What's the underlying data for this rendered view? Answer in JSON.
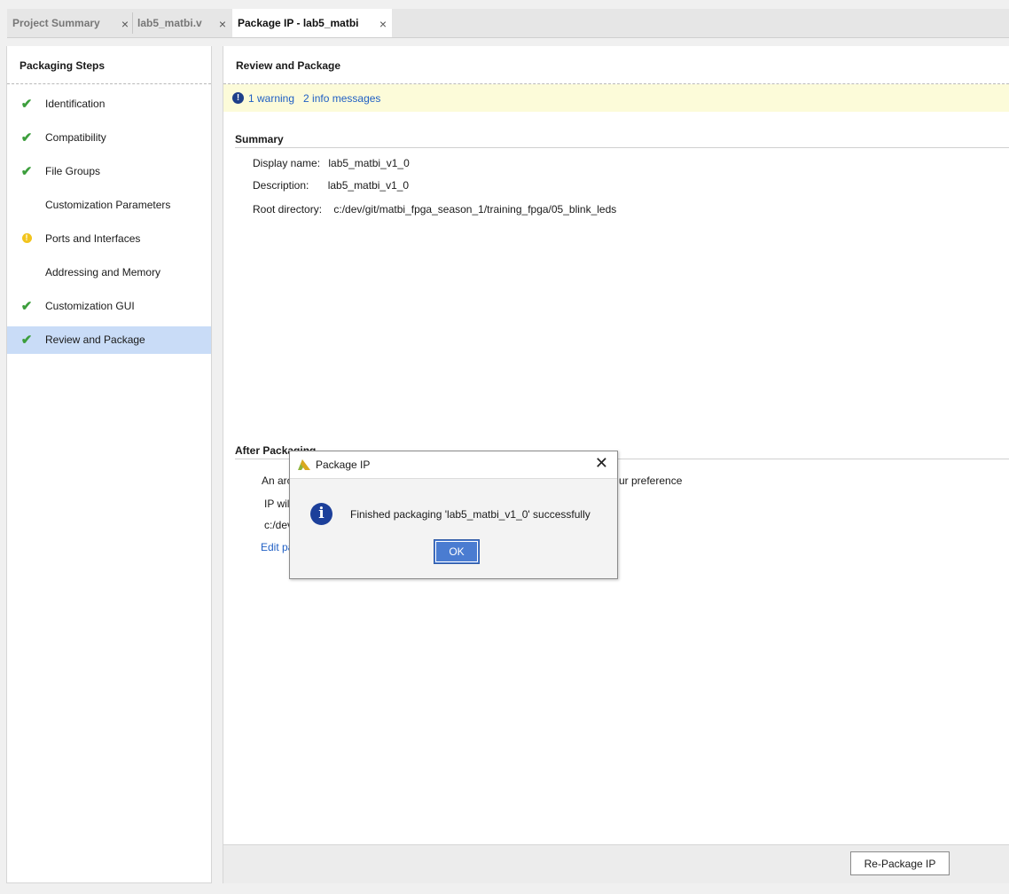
{
  "tabs": [
    {
      "label": "Project Summary",
      "close": "×"
    },
    {
      "label": "lab5_matbi.v",
      "close": "×"
    },
    {
      "label": "Package IP - lab5_matbi",
      "close": "×"
    }
  ],
  "steps_panel": {
    "title": "Packaging Steps",
    "items": [
      {
        "label": "Identification",
        "status": "✔"
      },
      {
        "label": "Compatibility",
        "status": "✔"
      },
      {
        "label": "File Groups",
        "status": "✔"
      },
      {
        "label": "Customization Parameters",
        "status": ""
      },
      {
        "label": "Ports and Interfaces",
        "status": "!"
      },
      {
        "label": "Addressing and Memory",
        "status": ""
      },
      {
        "label": "Customization GUI",
        "status": "✔"
      },
      {
        "label": "Review and Package",
        "status": "✔"
      }
    ]
  },
  "main": {
    "title": "Review and Package",
    "messages": {
      "icon": "!",
      "warning_link": "1 warning",
      "info_link": "2 info messages"
    },
    "summary": {
      "title": "Summary",
      "display_name_label": "Display name:",
      "display_name": "lab5_matbi_v1_0",
      "description_label": "Description:",
      "description": "lab5_matbi_v1_0",
      "root_dir_label": "Root directory:",
      "root_dir": "c:/dev/git/matbi_fpga_season_1/training_fpga/05_blink_leds"
    },
    "after_packaging": {
      "title": "After Packaging",
      "line1_start": "An arc",
      "line1_end": "ur preference",
      "line2": "IP wil",
      "line3": "c:/dev",
      "edit_link": "Edit pa"
    },
    "repackage_button": "Re-Package IP"
  },
  "dialog": {
    "title": "Package IP",
    "close": "✕",
    "info_icon": "i",
    "message": "Finished packaging 'lab5_matbi_v1_0' successfully",
    "ok": "OK"
  },
  "colors": {
    "accent": "#4a7cd1",
    "selected_row": "#c9dcf7",
    "message_bar": "#fcfbd9",
    "link": "#1f5fc4",
    "check": "#3c9e3c",
    "warning": "#f2c41d"
  }
}
